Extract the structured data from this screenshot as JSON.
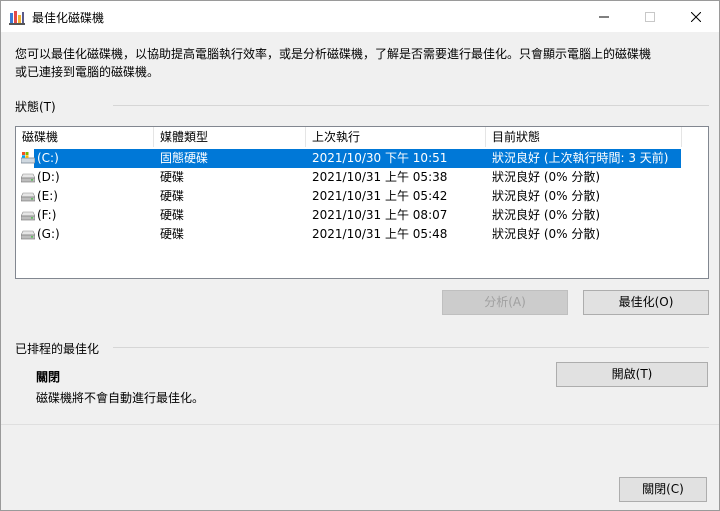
{
  "window": {
    "title": "最佳化磁碟機",
    "colors": {
      "selection": "#0078d7",
      "titlebar": "#ffffff",
      "body": "#f0f0f0"
    }
  },
  "description": {
    "line1": "您可以最佳化磁碟機，以協助提高電腦執行效率，或是分析磁碟機，了解是否需要進行最佳化。只會顯示電腦上的磁碟機",
    "line2": "或已連接到電腦的磁碟機。"
  },
  "status": {
    "label": "狀態(T)",
    "columns": [
      "磁碟機",
      "媒體類型",
      "上次執行",
      "目前狀態"
    ],
    "drives": [
      {
        "name": "(C:)",
        "media": "固態硬碟",
        "last_run": "2021/10/30 下午 10:51",
        "status": "狀況良好 (上次執行時間: 3 天前)",
        "icon": "ssd-system-drive-icon",
        "selected": true
      },
      {
        "name": "(D:)",
        "media": "硬碟",
        "last_run": "2021/10/31 上午 05:38",
        "status": "狀況良好 (0% 分散)",
        "icon": "hard-disk-icon",
        "selected": false
      },
      {
        "name": "(E:)",
        "media": "硬碟",
        "last_run": "2021/10/31 上午 05:42",
        "status": "狀況良好 (0% 分散)",
        "icon": "hard-disk-icon",
        "selected": false
      },
      {
        "name": "(F:)",
        "media": "硬碟",
        "last_run": "2021/10/31 上午 08:07",
        "status": "狀況良好 (0% 分散)",
        "icon": "hard-disk-icon",
        "selected": false
      },
      {
        "name": "(G:)",
        "media": "硬碟",
        "last_run": "2021/10/31 上午 05:48",
        "status": "狀況良好 (0% 分散)",
        "icon": "hard-disk-icon",
        "selected": false
      }
    ],
    "analyze_label": "分析(A)",
    "optimize_label": "最佳化(O)"
  },
  "schedule": {
    "label": "已排程的最佳化",
    "state": "關閉",
    "detail": "磁碟機將不會自動進行最佳化。",
    "enable_label": "開啟(T)"
  },
  "footer": {
    "close_label": "關閉(C)"
  }
}
